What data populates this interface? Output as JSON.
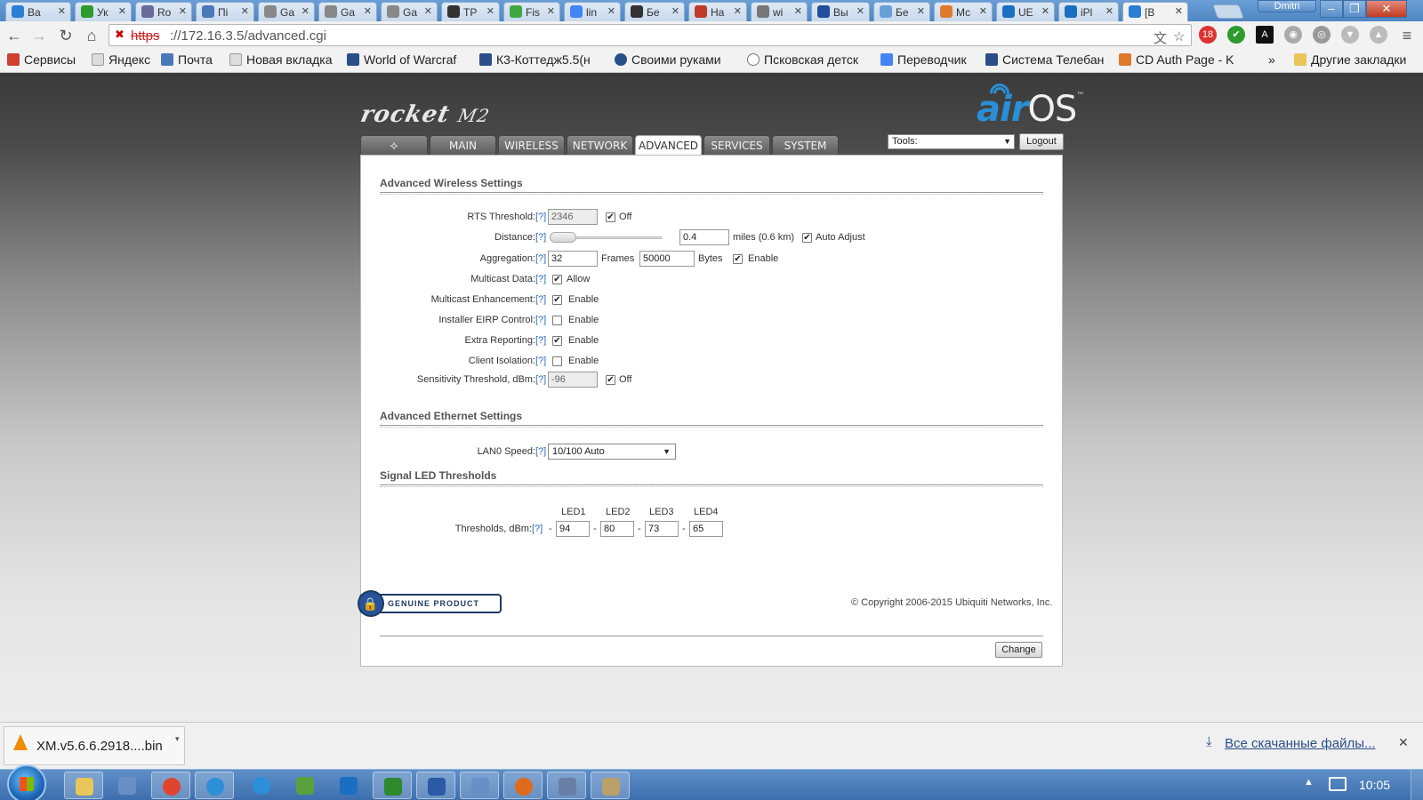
{
  "browser": {
    "tabs": [
      {
        "label": "Ba",
        "color": "#2a7fd4"
      },
      {
        "label": "Ук",
        "color": "#2d9b2d"
      },
      {
        "label": "Ro",
        "color": "#6a6a9a"
      },
      {
        "label": "Пі",
        "color": "#4a78b8"
      },
      {
        "label": "Ga",
        "color": "#888888"
      },
      {
        "label": "Ga",
        "color": "#888888"
      },
      {
        "label": "Ga",
        "color": "#888888"
      },
      {
        "label": "TP",
        "color": "#333333"
      },
      {
        "label": "Fis",
        "color": "#3fa93f"
      },
      {
        "label": "lin",
        "color": "#4285f4"
      },
      {
        "label": "Бе",
        "color": "#333333"
      },
      {
        "label": "На",
        "color": "#c0392b"
      },
      {
        "label": "wi",
        "color": "#777777"
      },
      {
        "label": "Вы",
        "color": "#1f4e9a"
      },
      {
        "label": "Бе",
        "color": "#6aa0d8"
      },
      {
        "label": "Мс",
        "color": "#e07a2b"
      },
      {
        "label": "UE",
        "color": "#1b6fc2"
      },
      {
        "label": "iPl",
        "color": "#1b6fc2"
      },
      {
        "label": "[B",
        "color": "#2a7fd4",
        "active": true
      }
    ],
    "user": "Dmitri",
    "url_scheme": "https",
    "url_rest": "://172.16.3.5/advanced.cgi",
    "bookmarks": [
      {
        "label": "Сервисы",
        "icon": "apps-icon",
        "color": "#d04030"
      },
      {
        "label": "Яндекс",
        "icon": "page-icon",
        "color": "#999999"
      },
      {
        "label": "Почта",
        "icon": "mail-icon",
        "color": "#4a78b8"
      },
      {
        "label": "Новая вкладка",
        "icon": "page-icon",
        "color": "#999999"
      },
      {
        "label": "World of Warcraf",
        "icon": "wow-icon",
        "color": "#2a4e8a"
      },
      {
        "label": "К3-Коттедж5.5(н",
        "icon": "k3-icon",
        "color": "#2a4e8a"
      },
      {
        "label": "Своими руками",
        "icon": "disk-icon",
        "color": "#2a4e8a"
      },
      {
        "label": "Псковская детск",
        "icon": "clock-icon",
        "color": "#777777"
      },
      {
        "label": "Переводчик",
        "icon": "translate-icon",
        "color": "#4285f4"
      },
      {
        "label": "Система Телебан",
        "icon": "bank-icon",
        "color": "#2a4e8a"
      },
      {
        "label": "CD Auth Page - K",
        "icon": "cd-icon",
        "color": "#e07a2b"
      }
    ],
    "other_bookmarks": "Другие закладки",
    "overflow": "»"
  },
  "airos": {
    "brand": "rocket",
    "model": "M2",
    "airos_air": "air",
    "airos_os": "OS",
    "airos_tm": "™",
    "tabs": [
      {
        "label": "",
        "icon": "ubnt-logo-icon"
      },
      {
        "label": "MAIN"
      },
      {
        "label": "WIRELESS"
      },
      {
        "label": "NETWORK"
      },
      {
        "label": "ADVANCED",
        "active": true
      },
      {
        "label": "SERVICES"
      },
      {
        "label": "SYSTEM"
      }
    ],
    "tools_label": "Tools:",
    "logout_label": "Logout",
    "help": "[?]",
    "sections": {
      "wireless": "Advanced Wireless Settings",
      "ethernet": "Advanced Ethernet Settings",
      "led": "Signal LED Thresholds"
    },
    "rts": {
      "label": "RTS Threshold:",
      "value": "2346",
      "off_label": "Off",
      "off_checked": true
    },
    "distance": {
      "label": "Distance:",
      "slider_level": 0.0,
      "value": "0.4",
      "unit": "miles (0.6 km)",
      "auto_label": "Auto Adjust",
      "auto_checked": true
    },
    "aggregation": {
      "label": "Aggregation:",
      "frames": "32",
      "frames_label": "Frames",
      "bytes": "50000",
      "bytes_label": "Bytes",
      "enable_label": "Enable",
      "enable_checked": true
    },
    "multicast_data": {
      "label": "Multicast Data:",
      "option": "Allow",
      "checked": true
    },
    "multicast_enh": {
      "label": "Multicast Enhancement:",
      "option": "Enable",
      "checked": true
    },
    "eirp": {
      "label": "Installer EIRP Control:",
      "option": "Enable",
      "checked": false
    },
    "extra_reporting": {
      "label": "Extra Reporting:",
      "option": "Enable",
      "checked": true
    },
    "client_isolation": {
      "label": "Client Isolation:",
      "option": "Enable",
      "checked": false
    },
    "sensitivity": {
      "label": "Sensitivity Threshold, dBm:",
      "value": "-96",
      "off_label": "Off",
      "off_checked": true
    },
    "lan0": {
      "label": "LAN0 Speed:",
      "value": "10/100 Auto"
    },
    "led": {
      "label": "Thresholds, dBm:",
      "headers": [
        "LED1",
        "LED2",
        "LED3",
        "LED4"
      ],
      "values": [
        "94",
        "80",
        "73",
        "65"
      ],
      "dash": "-"
    },
    "change_label": "Change",
    "genuine_label": "GENUINE PRODUCT",
    "copyright": "© Copyright 2006-2015 Ubiquiti Networks, Inc."
  },
  "downloads": {
    "file": "XM.v5.6.6.2918....bin",
    "all_label": "Все скачанные файлы..."
  },
  "taskbar": {
    "apps": [
      {
        "icon": "explorer-icon",
        "color": "#e8c65a",
        "on": true
      },
      {
        "icon": "network-icon",
        "color": "#6a8fc7",
        "on": false
      },
      {
        "icon": "chrome-icon",
        "color": "#e0442d",
        "on": true
      },
      {
        "icon": "skype-icon",
        "color": "#2d8fd8",
        "on": true
      },
      {
        "icon": "msn-icon",
        "color": "#2d8fd8",
        "on": false
      },
      {
        "icon": "stack-icon",
        "color": "#5aa03c",
        "on": false
      },
      {
        "icon": "ubnt-icon",
        "color": "#1b6fc2",
        "on": false
      },
      {
        "icon": "excel-icon",
        "color": "#2d8a2d",
        "on": true
      },
      {
        "icon": "word-icon",
        "color": "#2a5aa8",
        "on": true
      },
      {
        "icon": "remote-icon",
        "color": "#6a8fc7",
        "on": true
      },
      {
        "icon": "firefox-icon",
        "color": "#e06a1b",
        "on": true
      },
      {
        "icon": "box-icon",
        "color": "#6a7fa8",
        "on": true
      },
      {
        "icon": "tool-icon",
        "color": "#b8a068",
        "on": true
      }
    ],
    "clock": "10:05"
  }
}
